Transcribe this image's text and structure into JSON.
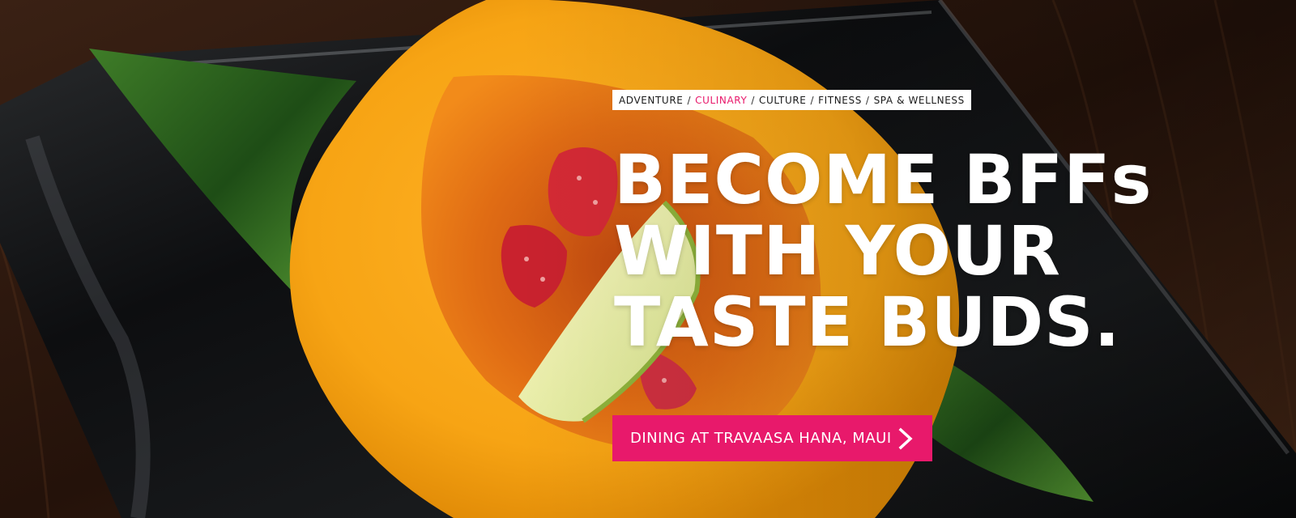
{
  "hero": {
    "categories": [
      {
        "label": "ADVENTURE",
        "active": false
      },
      {
        "label": "CULINARY",
        "active": true
      },
      {
        "label": "CULTURE",
        "active": false
      },
      {
        "label": "FITNESS",
        "active": false
      },
      {
        "label": "SPA & WELLNESS",
        "active": false
      }
    ],
    "separator": "/",
    "headline": {
      "line1": "BECOME BFFs",
      "line2": "WITH YOUR",
      "line3": "TASTE BUDS."
    },
    "cta": {
      "label": "DINING AT TRAVAASA HANA, MAUI",
      "icon": "chevron-right-icon"
    }
  },
  "colors": {
    "accent": "#e8196b",
    "headline": "#ffffff",
    "category_bg": "#ffffff"
  }
}
